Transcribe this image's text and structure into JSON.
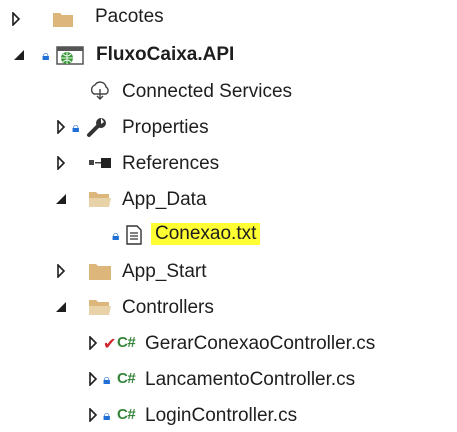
{
  "tree": {
    "items": [
      {
        "label": "Pacotes"
      },
      {
        "label": "FluxoCaixa.API"
      },
      {
        "label": "Connected Services"
      },
      {
        "label": "Properties"
      },
      {
        "label": "References"
      },
      {
        "label": "App_Data"
      },
      {
        "label": "Conexao.txt"
      },
      {
        "label": "App_Start"
      },
      {
        "label": "Controllers"
      },
      {
        "label": "GerarConexaoController.cs"
      },
      {
        "label": "LancamentoController.cs"
      },
      {
        "label": "LoginController.cs"
      }
    ],
    "cs_badge": "C#"
  },
  "colors": {
    "highlight": "#ffff33",
    "folder": "#dcb67a",
    "lock": "#1f6fd6",
    "csharp": "#36853a",
    "check": "#d0232b"
  }
}
